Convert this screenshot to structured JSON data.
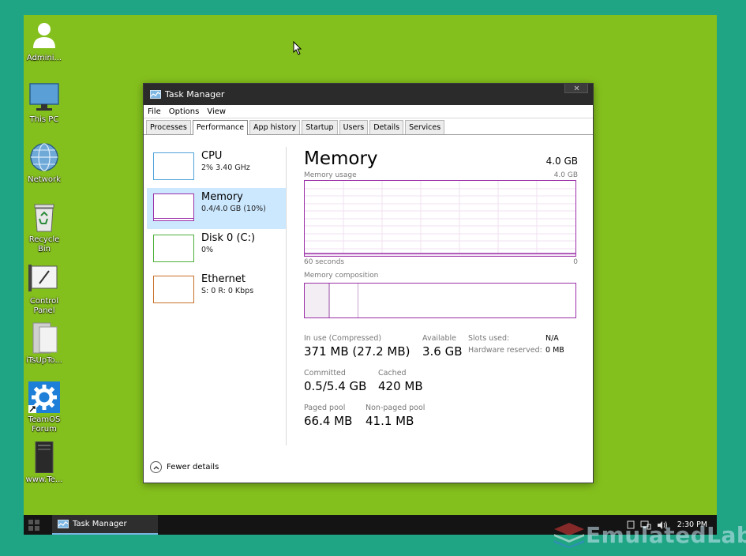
{
  "desktop": {
    "icons": [
      {
        "label": "Admini...",
        "icon": "user-icon"
      },
      {
        "label": "This PC",
        "icon": "computer-icon"
      },
      {
        "label": "Network",
        "icon": "network-globe-icon"
      },
      {
        "label": "Recycle\nBin",
        "icon": "recycle-bin-icon"
      },
      {
        "label": "Control\nPanel",
        "icon": "control-panel-icon"
      },
      {
        "label": "iTsUpTo...",
        "icon": "folder-icon"
      },
      {
        "label": "TeamOS\nForum",
        "icon": "gear-shortcut-icon"
      },
      {
        "label": "www.Te...",
        "icon": "dark-file-icon"
      }
    ]
  },
  "window": {
    "title": "Task Manager",
    "menu": [
      "File",
      "Options",
      "View"
    ],
    "tabs": [
      "Processes",
      "Performance",
      "App history",
      "Startup",
      "Users",
      "Details",
      "Services"
    ],
    "active_tab": "Performance",
    "left_items": [
      {
        "name": "CPU",
        "detail": "2% 3.40 GHz",
        "color": "#4fa3d9"
      },
      {
        "name": "Memory",
        "detail": "0.4/4.0 GB (10%)",
        "color": "#9b2fa8"
      },
      {
        "name": "Disk 0 (C:)",
        "detail": "0%",
        "color": "#4db03a"
      },
      {
        "name": "Ethernet",
        "detail": "S: 0 R: 0 Kbps",
        "color": "#c8702a"
      }
    ],
    "selected_item": "Memory",
    "memory": {
      "title": "Memory",
      "total": "4.0 GB",
      "usage_label": "Memory usage",
      "usage_max": "4.0 GB",
      "time_left": "60 seconds",
      "time_right": "0",
      "composition_label": "Memory composition",
      "usage_fraction": 0.1,
      "in_use_label": "In use (Compressed)",
      "in_use_value": "371 MB (27.2 MB)",
      "available_label": "Available",
      "available_value": "3.6 GB",
      "committed_label": "Committed",
      "committed_value": "0.5/5.4 GB",
      "cached_label": "Cached",
      "cached_value": "420 MB",
      "paged_label": "Paged pool",
      "paged_value": "66.4 MB",
      "nonpaged_label": "Non-paged pool",
      "nonpaged_value": "41.1 MB",
      "slots_label": "Slots used:",
      "slots_value": "N/A",
      "hwres_label": "Hardware reserved:",
      "hwres_value": "0 MB"
    },
    "fewer_details": "Fewer details"
  },
  "taskbar": {
    "app_label": "Task Manager",
    "clock": "2:30 PM"
  },
  "watermark": "EmulatedLab",
  "colors": {
    "desktop": "#84c01d",
    "frame": "#1fa584",
    "memory_accent": "#9b2fa8",
    "selection": "#cce8ff"
  }
}
